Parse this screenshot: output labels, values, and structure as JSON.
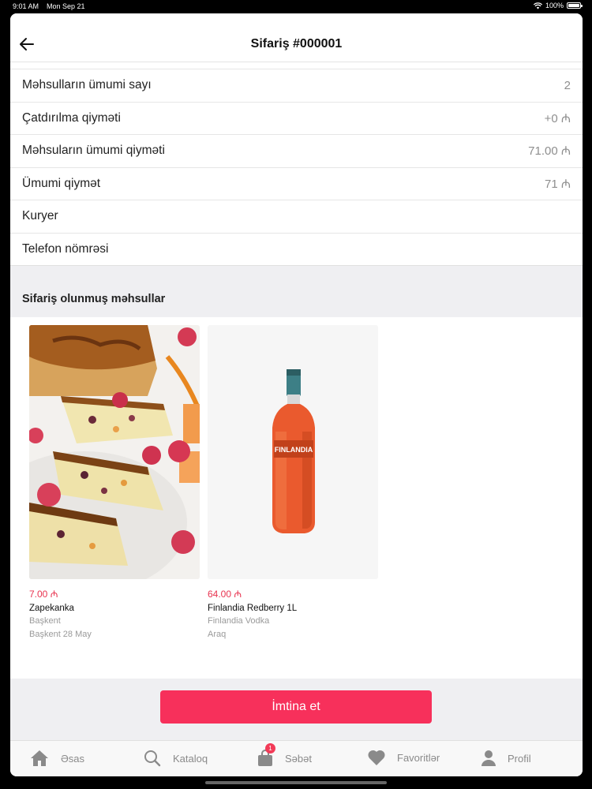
{
  "status_bar": {
    "time": "9:01 AM",
    "date": "Mon Sep 21",
    "battery": "100%"
  },
  "header": {
    "title": "Sifariş #000001"
  },
  "summary": [
    {
      "label": "Məhsulların ümumi sayı",
      "value": "2"
    },
    {
      "label": "Çatdırılma qiyməti",
      "value": "+0 ₼"
    },
    {
      "label": "Məhsuların ümumi qiyməti",
      "value": "71.00 ₼"
    },
    {
      "label": "Ümumi qiymət",
      "value": "71 ₼"
    },
    {
      "label": "Kuryer",
      "value": ""
    },
    {
      "label": "Telefon nömrəsi",
      "value": ""
    }
  ],
  "ordered_section": {
    "title": "Sifariş olunmuş məhsullar"
  },
  "products": [
    {
      "price": "7.00 ₼",
      "name": "Zapekanka",
      "brand": "Başkent",
      "extra": "Başkent 28 May"
    },
    {
      "price": "64.00 ₼",
      "name": "Finlandia Redberry 1L",
      "brand": "Finlandia Vodka",
      "extra": "Araq"
    }
  ],
  "cancel_button": {
    "label": "İmtina et"
  },
  "tabbar": {
    "items": [
      {
        "label": "Əsas",
        "icon": "home-icon"
      },
      {
        "label": "Kataloq",
        "icon": "search-icon"
      },
      {
        "label": "Səbət",
        "icon": "bag-icon",
        "badge": "1"
      },
      {
        "label": "Favoritlər",
        "icon": "heart-icon"
      },
      {
        "label": "Profil",
        "icon": "person-icon"
      }
    ]
  },
  "colors": {
    "accent": "#f7305b",
    "price": "#e8334f",
    "section_bg": "#efeff2"
  }
}
